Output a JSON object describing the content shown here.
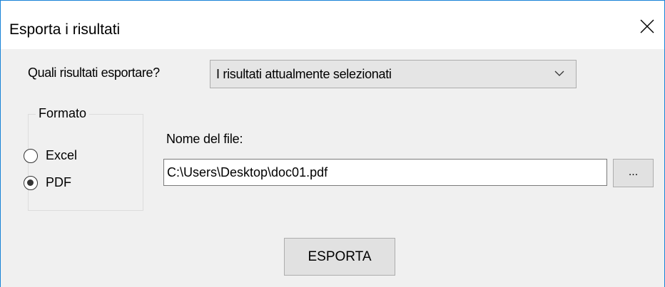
{
  "window": {
    "title": "Esporta i risultati",
    "close_icon": "close-icon",
    "accent_color": "#1883d7"
  },
  "question": {
    "label": "Quali risultati esportare?",
    "selected": "I risultati attualmente selezionati",
    "dropdown_icon": "chevron-down-icon"
  },
  "format": {
    "legend": "Formato",
    "options": [
      {
        "label": "Excel",
        "checked": false
      },
      {
        "label": "PDF",
        "checked": true
      }
    ]
  },
  "file": {
    "label": "Nome del file:",
    "value": "C:\\Users\\Desktop\\doc01.pdf",
    "browse_label": "..."
  },
  "actions": {
    "export_label": "ESPORTA"
  }
}
